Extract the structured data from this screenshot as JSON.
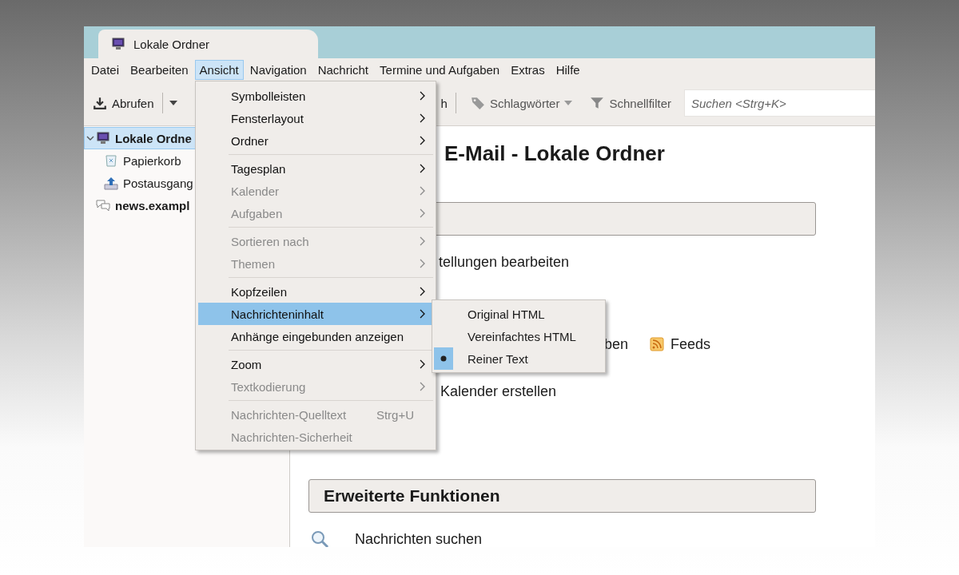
{
  "window": {
    "tab": {
      "title": "Lokale Ordner"
    }
  },
  "menubar": [
    {
      "label": "Datei",
      "selected": false
    },
    {
      "label": "Bearbeiten",
      "selected": false
    },
    {
      "label": "Ansicht",
      "selected": true
    },
    {
      "label": "Navigation",
      "selected": false
    },
    {
      "label": "Nachricht",
      "selected": false
    },
    {
      "label": "Termine und Aufgaben",
      "selected": false
    },
    {
      "label": "Extras",
      "selected": false
    },
    {
      "label": "Hilfe",
      "selected": false
    }
  ],
  "toolbar": {
    "get_messages": "Abrufen",
    "partial_button": "h",
    "tags": "Schlagwörter",
    "quick_filter": "Schnellfilter",
    "search": {
      "placeholder": "Suchen <Strg+K>"
    }
  },
  "folders": [
    {
      "label": "Lokale Ordne",
      "kind": "local",
      "selected": true,
      "expanded": true,
      "children": [
        {
          "label": "Papierkorb",
          "kind": "trash",
          "selected": false
        },
        {
          "label": "Postausgang",
          "kind": "outbox",
          "selected": false
        }
      ]
    },
    {
      "label": "news.exampl",
      "kind": "news",
      "selected": false
    }
  ],
  "content": {
    "heading": "E-Mail - Lokale Ordner",
    "sections": [
      {
        "rows": [
          [
            {
              "kind": "text",
              "label": "tellungen bearbeiten"
            }
          ],
          [
            {
              "kind": "text",
              "label": "ben"
            },
            {
              "kind": "feed",
              "label": "Feeds"
            }
          ],
          [
            {
              "kind": "text",
              "label": "Kalender erstellen"
            }
          ]
        ]
      },
      {
        "title": "Erweiterte Funktionen",
        "rows": [
          [
            {
              "kind": "search",
              "label": "Nachrichten suchen"
            }
          ]
        ]
      }
    ]
  },
  "view_menu": {
    "items": [
      {
        "kind": "item",
        "label": "Symbolleisten",
        "disabled": false,
        "submenu": true,
        "selected": false
      },
      {
        "kind": "item",
        "label": "Fensterlayout",
        "disabled": false,
        "submenu": true,
        "selected": false
      },
      {
        "kind": "item",
        "label": "Ordner",
        "disabled": false,
        "submenu": true,
        "selected": false
      },
      {
        "kind": "separator"
      },
      {
        "kind": "item",
        "label": "Tagesplan",
        "disabled": false,
        "submenu": true,
        "selected": false
      },
      {
        "kind": "item",
        "label": "Kalender",
        "disabled": true,
        "submenu": true,
        "selected": false
      },
      {
        "kind": "item",
        "label": "Aufgaben",
        "disabled": true,
        "submenu": true,
        "selected": false
      },
      {
        "kind": "separator"
      },
      {
        "kind": "item",
        "label": "Sortieren nach",
        "disabled": true,
        "submenu": true,
        "selected": false
      },
      {
        "kind": "item",
        "label": "Themen",
        "disabled": true,
        "submenu": true,
        "selected": false
      },
      {
        "kind": "separator"
      },
      {
        "kind": "item",
        "label": "Kopfzeilen",
        "disabled": false,
        "submenu": true,
        "selected": false
      },
      {
        "kind": "item",
        "label": "Nachrichteninhalt",
        "disabled": false,
        "submenu": true,
        "selected": true
      },
      {
        "kind": "item",
        "label": "Anhänge eingebunden anzeigen",
        "disabled": false,
        "submenu": false,
        "selected": false
      },
      {
        "kind": "separator"
      },
      {
        "kind": "item",
        "label": "Zoom",
        "disabled": false,
        "submenu": true,
        "selected": false
      },
      {
        "kind": "item",
        "label": "Textkodierung",
        "disabled": true,
        "submenu": true,
        "selected": false
      },
      {
        "kind": "separator"
      },
      {
        "kind": "item",
        "label": "Nachrichten-Quelltext",
        "shortcut": "Strg+U",
        "disabled": true,
        "submenu": false,
        "selected": false
      },
      {
        "kind": "item",
        "label": "Nachrichten-Sicherheit",
        "disabled": true,
        "submenu": false,
        "selected": false
      }
    ]
  },
  "content_submenu": {
    "items": [
      {
        "label": "Original HTML",
        "selected": false
      },
      {
        "label": "Vereinfachtes HTML",
        "selected": false
      },
      {
        "label": "Reiner Text",
        "selected": true
      }
    ]
  }
}
